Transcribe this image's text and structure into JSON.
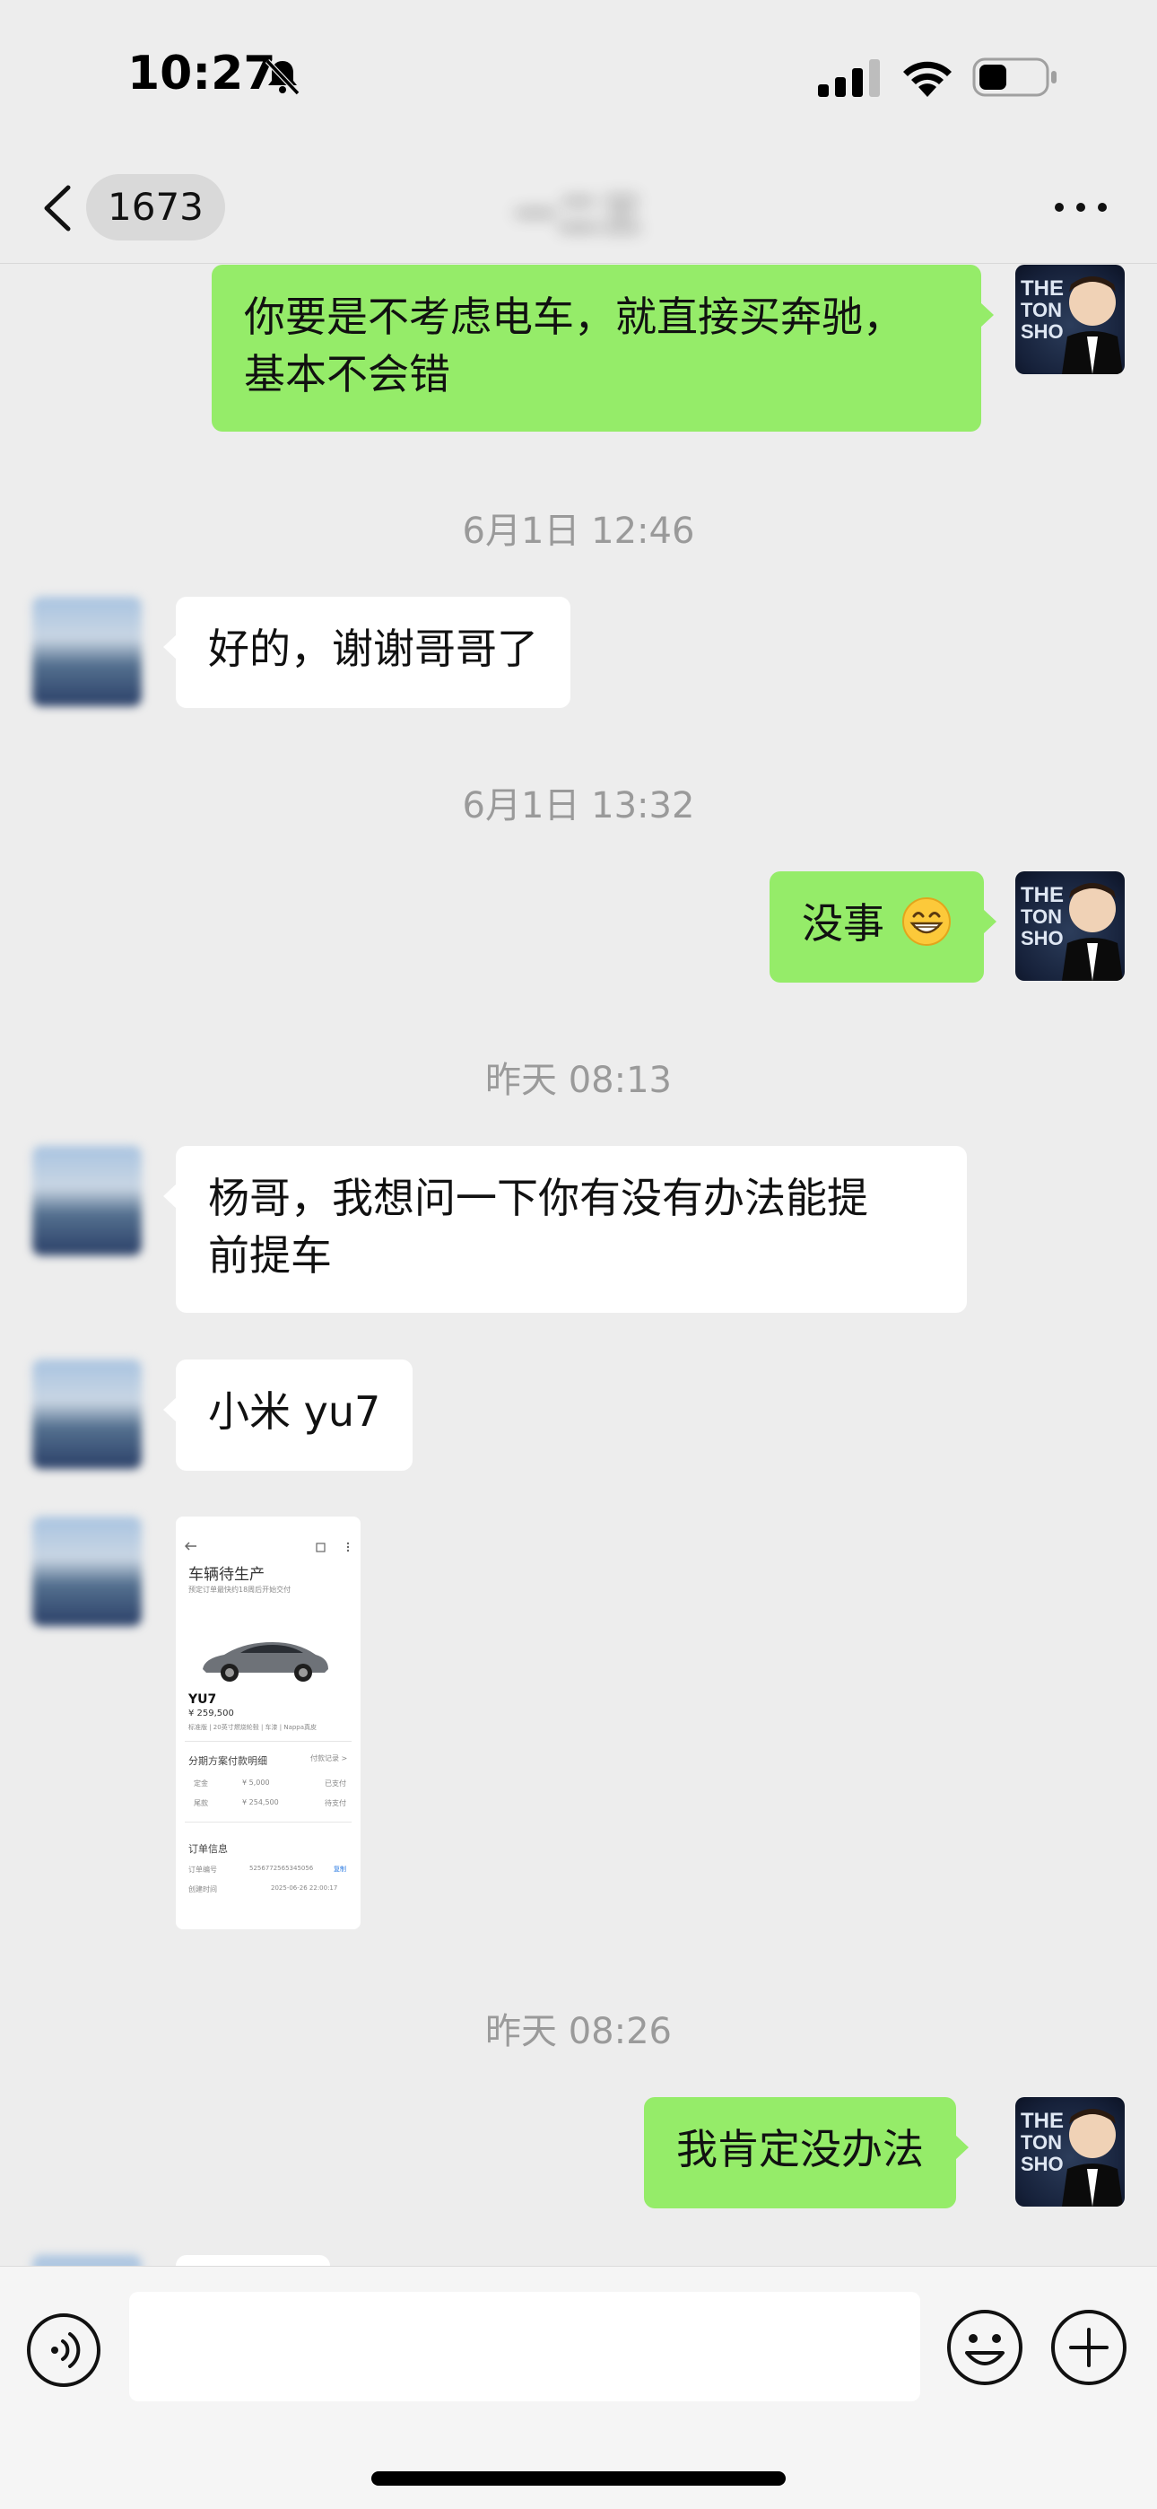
{
  "status_bar": {
    "time": "10:27",
    "icons": [
      "bell-muted-icon",
      "signal-icon",
      "wifi-icon",
      "battery-icon"
    ]
  },
  "nav": {
    "unread_count": "1673",
    "title": "一二三",
    "icons": [
      "chevron-left-icon",
      "more-icon"
    ]
  },
  "messages": {
    "m1": "你要是不考虑电车，就直接买奔驰，",
    "m1b": "基本不会错",
    "t1": "6月1日 12:46",
    "m2": "好的，谢谢哥哥了",
    "t2": "6月1日 13:32",
    "m3": "没事",
    "t3": "昨天 08:13",
    "m4": "杨哥，我想问一下你有没有办法能提",
    "m4b": "前提车",
    "m5": "小米 yu7",
    "t4": "昨天 08:26",
    "m6": "我肯定没办法"
  },
  "image_message": {
    "status_title": "车辆待生产",
    "status_sub": "预定订单最快约18周后开始交付",
    "model": "YU7",
    "price": "¥ 259,500",
    "config": "标准版 | 20英寸燃烧轮毂 | 车漆 | Nappa真皮",
    "plan_title": "分期方案付款明细",
    "plan_link": "付款记录 >",
    "row1_label": "定金",
    "row1_amount": "¥ 5,000",
    "row1_status": "已支付",
    "row2_label": "尾款",
    "row2_amount": "¥ 254,500",
    "row2_status": "待支付",
    "order_title": "订单信息",
    "order_no_label": "订单编号",
    "order_no": "5256772565345056",
    "order_copy": "复制",
    "order_time_label": "创建时间",
    "order_time": "2025-06-26 22:00:17"
  },
  "input": {
    "placeholder": "",
    "icons": [
      "voice-icon",
      "emoji-icon",
      "plus-icon"
    ]
  },
  "colors": {
    "self_bubble": "#95ec69",
    "other_bubble": "#ffffff",
    "background": "#ededed",
    "timestamp": "#9a9a9a"
  }
}
